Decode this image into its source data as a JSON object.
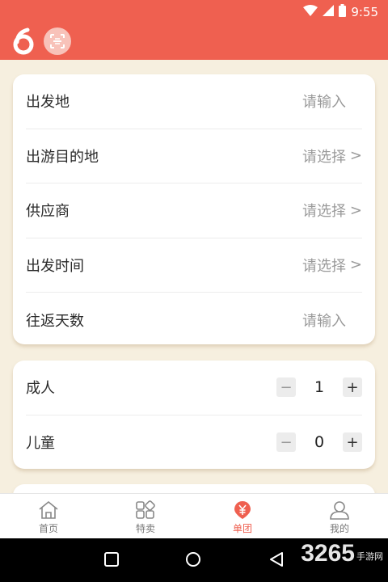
{
  "status_bar": {
    "time": "9:55"
  },
  "form": {
    "rows": [
      {
        "label": "出发地",
        "value": "请输入",
        "chevron": ""
      },
      {
        "label": "出游目的地",
        "value": "请选择",
        "chevron": ">"
      },
      {
        "label": "供应商",
        "value": "请选择",
        "chevron": ">"
      },
      {
        "label": "出发时间",
        "value": "请选择",
        "chevron": ">"
      },
      {
        "label": "往返天数",
        "value": "请输入",
        "chevron": ""
      }
    ]
  },
  "travelers": {
    "adult": {
      "label": "成人",
      "minus": "−",
      "value": "1",
      "plus": "+"
    },
    "child": {
      "label": "儿童",
      "minus": "−",
      "value": "0",
      "plus": "+"
    }
  },
  "tabs": [
    {
      "label": "首页",
      "icon": "home-icon"
    },
    {
      "label": "特卖",
      "icon": "grid-icon"
    },
    {
      "label": "单团",
      "icon": "yuan-icon"
    },
    {
      "label": "我的",
      "icon": "user-icon"
    }
  ],
  "active_tab": "单团",
  "watermark": {
    "big": "3265",
    "small": "手游网"
  },
  "colors": {
    "accent": "#ef6050",
    "background": "#f6efdf"
  }
}
